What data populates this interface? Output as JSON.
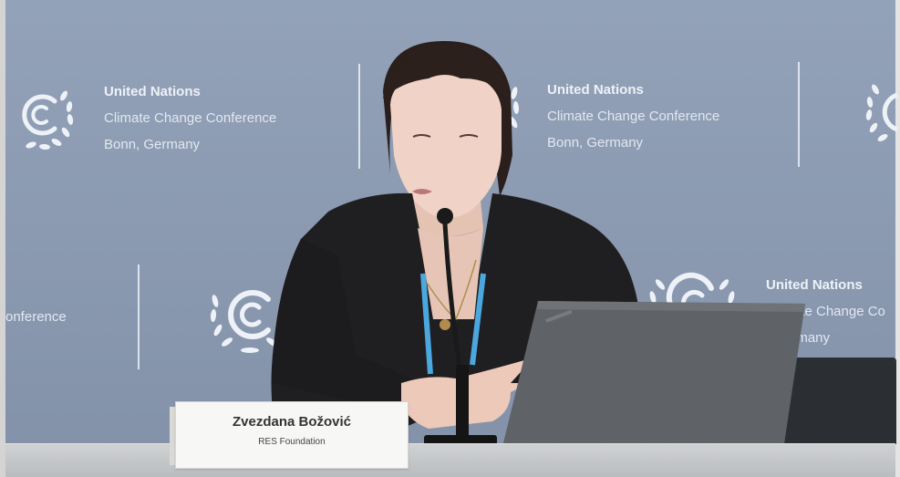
{
  "backdrop": {
    "brand_blocks": [
      {
        "org": "United Nations",
        "conference": "Climate Change Conference",
        "location": "Bonn, Germany"
      },
      {
        "org": "United Nations",
        "conference": "Climate Change Conference",
        "location": "Bonn, Germany"
      },
      {
        "org": "United Nations",
        "conference": "Climate Change Co",
        "location": ", Germany"
      }
    ],
    "partial_text": "onference",
    "logo_name": "unfccc-laurel-logo"
  },
  "speaker": {
    "name": "Zvezdana Božović",
    "organization": "RES Foundation"
  },
  "colors": {
    "backdrop": "#8e9db3",
    "shirt": "#1e1e20",
    "lanyard": "#4aa8df",
    "laptop": "#5e6166",
    "table": "#c4c6c8"
  }
}
